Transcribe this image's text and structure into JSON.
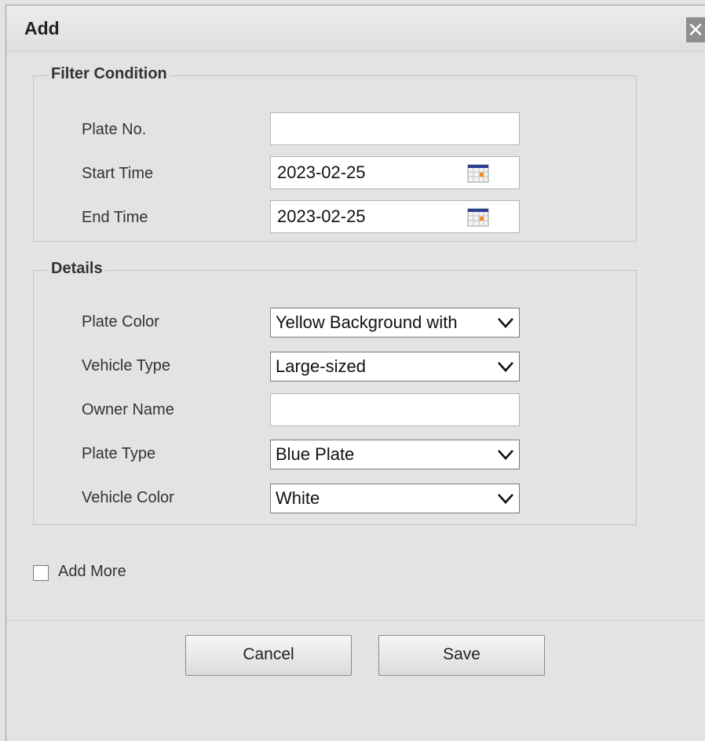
{
  "dialog": {
    "title": "Add",
    "close_glyph": "✕"
  },
  "filter": {
    "legend": "Filter Condition",
    "plate_no_label": "Plate No.",
    "plate_no_value": "",
    "start_time_label": "Start Time",
    "start_time_value": "2023-02-25",
    "end_time_label": "End Time",
    "end_time_value": "2023-02-25",
    "calendar_icon": "calendar-icon"
  },
  "details": {
    "legend": "Details",
    "plate_color_label": "Plate Color",
    "plate_color_value": "Yellow Background with",
    "vehicle_type_label": "Vehicle Type",
    "vehicle_type_value": "Large-sized",
    "owner_name_label": "Owner Name",
    "owner_name_value": "",
    "plate_type_label": "Plate Type",
    "plate_type_value": "Blue Plate",
    "vehicle_color_label": "Vehicle Color",
    "vehicle_color_value": "White"
  },
  "add_more": {
    "label": "Add More",
    "checked": false
  },
  "buttons": {
    "cancel": "Cancel",
    "save": "Save"
  },
  "colors": {
    "background": "#e3e3e3",
    "close_bg": "#8e8e8e"
  }
}
